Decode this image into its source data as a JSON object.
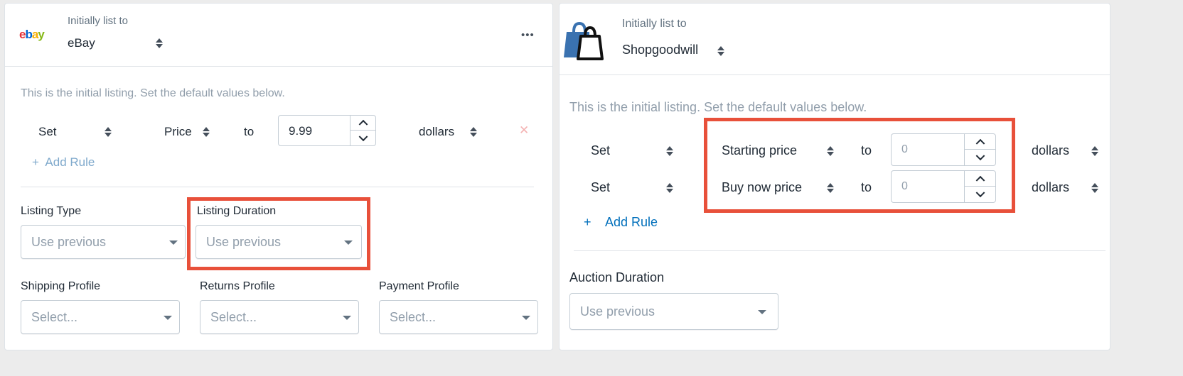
{
  "colors": {
    "highlight": "#e8503a",
    "link": "#006fbb",
    "ebay_red": "#e53238",
    "ebay_blue": "#0064d2",
    "ebay_yellow": "#f5af02",
    "ebay_green": "#86b817",
    "bag_blue": "#3a72b0"
  },
  "ebay_card": {
    "logo_text": {
      "e": "e",
      "b": "b",
      "a": "a",
      "y": "y"
    },
    "initially_list_label": "Initially list to",
    "channel": "eBay",
    "more_label": "•••",
    "intro": "This is the initial listing. Set the default values below.",
    "rule": {
      "action": "Set",
      "field": "Price",
      "to": "to",
      "value": "9.99",
      "unit": "dollars",
      "remove": "✕"
    },
    "add_rule": "+  Add Rule",
    "listing_type": {
      "label": "Listing Type",
      "value": "Use previous"
    },
    "listing_duration": {
      "label": "Listing Duration",
      "value": "Use previous"
    },
    "shipping_profile": {
      "label": "Shipping Profile",
      "placeholder": "Select..."
    },
    "returns_profile": {
      "label": "Returns Profile",
      "placeholder": "Select..."
    },
    "payment_profile": {
      "label": "Payment Profile",
      "placeholder": "Select..."
    }
  },
  "sgw_card": {
    "initially_list_label": "Initially list to",
    "channel": "Shopgoodwill",
    "intro": "This is the initial listing. Set the default values below.",
    "rules": [
      {
        "action": "Set",
        "field": "Starting price",
        "to": "to",
        "value": "0",
        "unit": "dollars"
      },
      {
        "action": "Set",
        "field": "Buy now price",
        "to": "to",
        "value": "0",
        "unit": "dollars"
      }
    ],
    "add_rule_plus": "+",
    "add_rule": "Add Rule",
    "auction_duration": {
      "label": "Auction Duration",
      "value": "Use previous"
    }
  }
}
